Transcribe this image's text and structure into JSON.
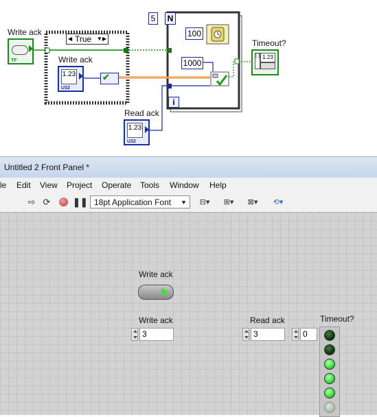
{
  "block_diagram": {
    "write_ack_label": "Write ack",
    "read_ack_label": "Read ack",
    "timeout_label": "Timeout?",
    "case_selector": "True",
    "inner_write_ack_label": "Write ack",
    "n_terminal": "N",
    "loop_count": "5",
    "wait_ms": "100",
    "timeout_ms": "1000",
    "iteration_terminal": "i",
    "numeric_display": "1.23",
    "numeric_type": "U32",
    "bool_type": "TF",
    "array_type": "1.23"
  },
  "window": {
    "title": "Untitled 2 Front Panel *"
  },
  "menu": {
    "items": [
      "le",
      "Edit",
      "View",
      "Project",
      "Operate",
      "Tools",
      "Window",
      "Help"
    ]
  },
  "toolbar": {
    "font": "18pt Application Font"
  },
  "front_panel": {
    "write_ack_bool_label": "Write ack",
    "write_ack_num_label": "Write ack",
    "write_ack_value": "3",
    "read_ack_label": "Read ack",
    "read_ack_value": "3",
    "timeout_label": "Timeout?",
    "array_index": "0",
    "timeout_leds": [
      false,
      false,
      true,
      true,
      true,
      false
    ]
  },
  "colors": {
    "bool_wire": "#1a8a1a",
    "numeric_wire": "#1a2aa0",
    "cluster_wire": "#f07a10",
    "led_on": "#3ee03e",
    "led_off": "#0d3a0d",
    "panel_bg": "#d3d3d3"
  }
}
